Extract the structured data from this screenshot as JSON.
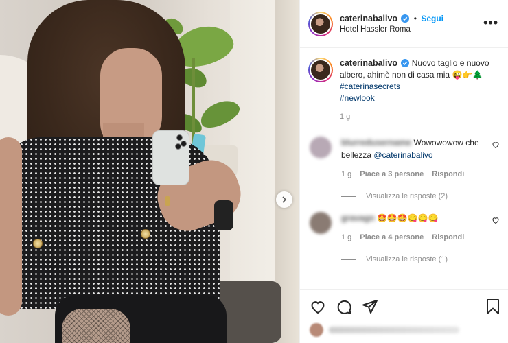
{
  "post": {
    "username": "caterinabalivo",
    "follow_label": "Segui",
    "separator": "•",
    "location": "Hotel Hassler Roma",
    "more_label": "•••"
  },
  "caption": {
    "username": "caterinabalivo",
    "text": "Nuovo taglio e nuovo albero, ahimè non di casa mia",
    "emoji": "😜👉🌲",
    "hashtags": [
      "#caterinasecrets",
      "#newlook"
    ],
    "time": "1 g"
  },
  "comments": [
    {
      "username": "blurredusername",
      "text": "Wowowowow che bellezza",
      "mention": "@caterinabalivo",
      "time": "1 g",
      "likes": "Piace a 3 persone",
      "reply_label": "Rispondi",
      "view_replies": "Visualizza le risposte (2)",
      "avatar_color": "#b8a9b5"
    },
    {
      "username": "gravagn",
      "text": "🤩🤩🤩😋😋😋",
      "time": "1 g",
      "likes": "Piace a 4 persone",
      "reply_label": "Rispondi",
      "view_replies": "Visualizza le risposte (1)",
      "avatar_color": "#8a7b73"
    }
  ],
  "icons": {
    "like": "heart-icon",
    "comment": "comment-icon",
    "share": "paper-plane-icon",
    "save": "bookmark-icon",
    "next": "chevron-right-icon",
    "verified": "verified-badge-icon"
  },
  "colors": {
    "follow": "#0095f6",
    "hashtag": "#00376b",
    "muted": "#8e8e8e",
    "verified": "#3897f0"
  }
}
